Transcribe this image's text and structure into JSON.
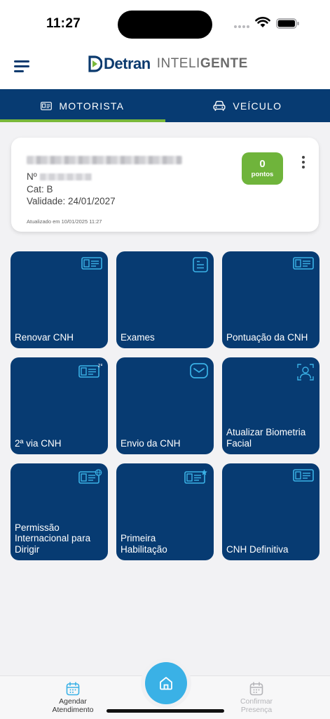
{
  "status_bar": {
    "time": "11:27"
  },
  "header": {
    "brand": "Detran",
    "product_light": "INTELI",
    "product_bold": "GENTE"
  },
  "tabs": [
    {
      "label": "MOTORISTA",
      "icon": "license-card-icon",
      "active": true
    },
    {
      "label": "VEÍCULO",
      "icon": "car-icon",
      "active": false
    }
  ],
  "license_card": {
    "number_label": "Nº",
    "category": "Cat: B",
    "validity": "Validade: 24/01/2027",
    "updated": "Atualizado em 10/01/2025 11:27",
    "points_value": "0",
    "points_label": "pontos"
  },
  "services": [
    {
      "label": "Renovar CNH",
      "icon": "id-card-icon"
    },
    {
      "label": "Exames",
      "icon": "document-icon"
    },
    {
      "label": "Pontuação da CNH",
      "icon": "id-card-icon"
    },
    {
      "label": "2ª via CNH",
      "icon": "id-card-second-copy-icon",
      "badge": "2ª"
    },
    {
      "label": "Envio da CNH",
      "icon": "mail-icon"
    },
    {
      "label": "Atualizar Biometria\nFacial",
      "icon": "face-scan-icon"
    },
    {
      "label": "Permissão\nInternacional para\nDirigir",
      "icon": "id-card-globe-icon"
    },
    {
      "label": "Primeira\nHabilitação",
      "icon": "id-card-star-icon"
    },
    {
      "label": "CNH Definitiva",
      "icon": "id-card-icon"
    }
  ],
  "bottom_nav": {
    "left": "Agendar\nAtendimento",
    "right": "Confirmar\nPresença"
  },
  "colors": {
    "primary_navy": "#073b72",
    "accent_green": "#79b83a",
    "points_green": "#6fb43b",
    "icon_cyan": "#3ab1e6"
  }
}
